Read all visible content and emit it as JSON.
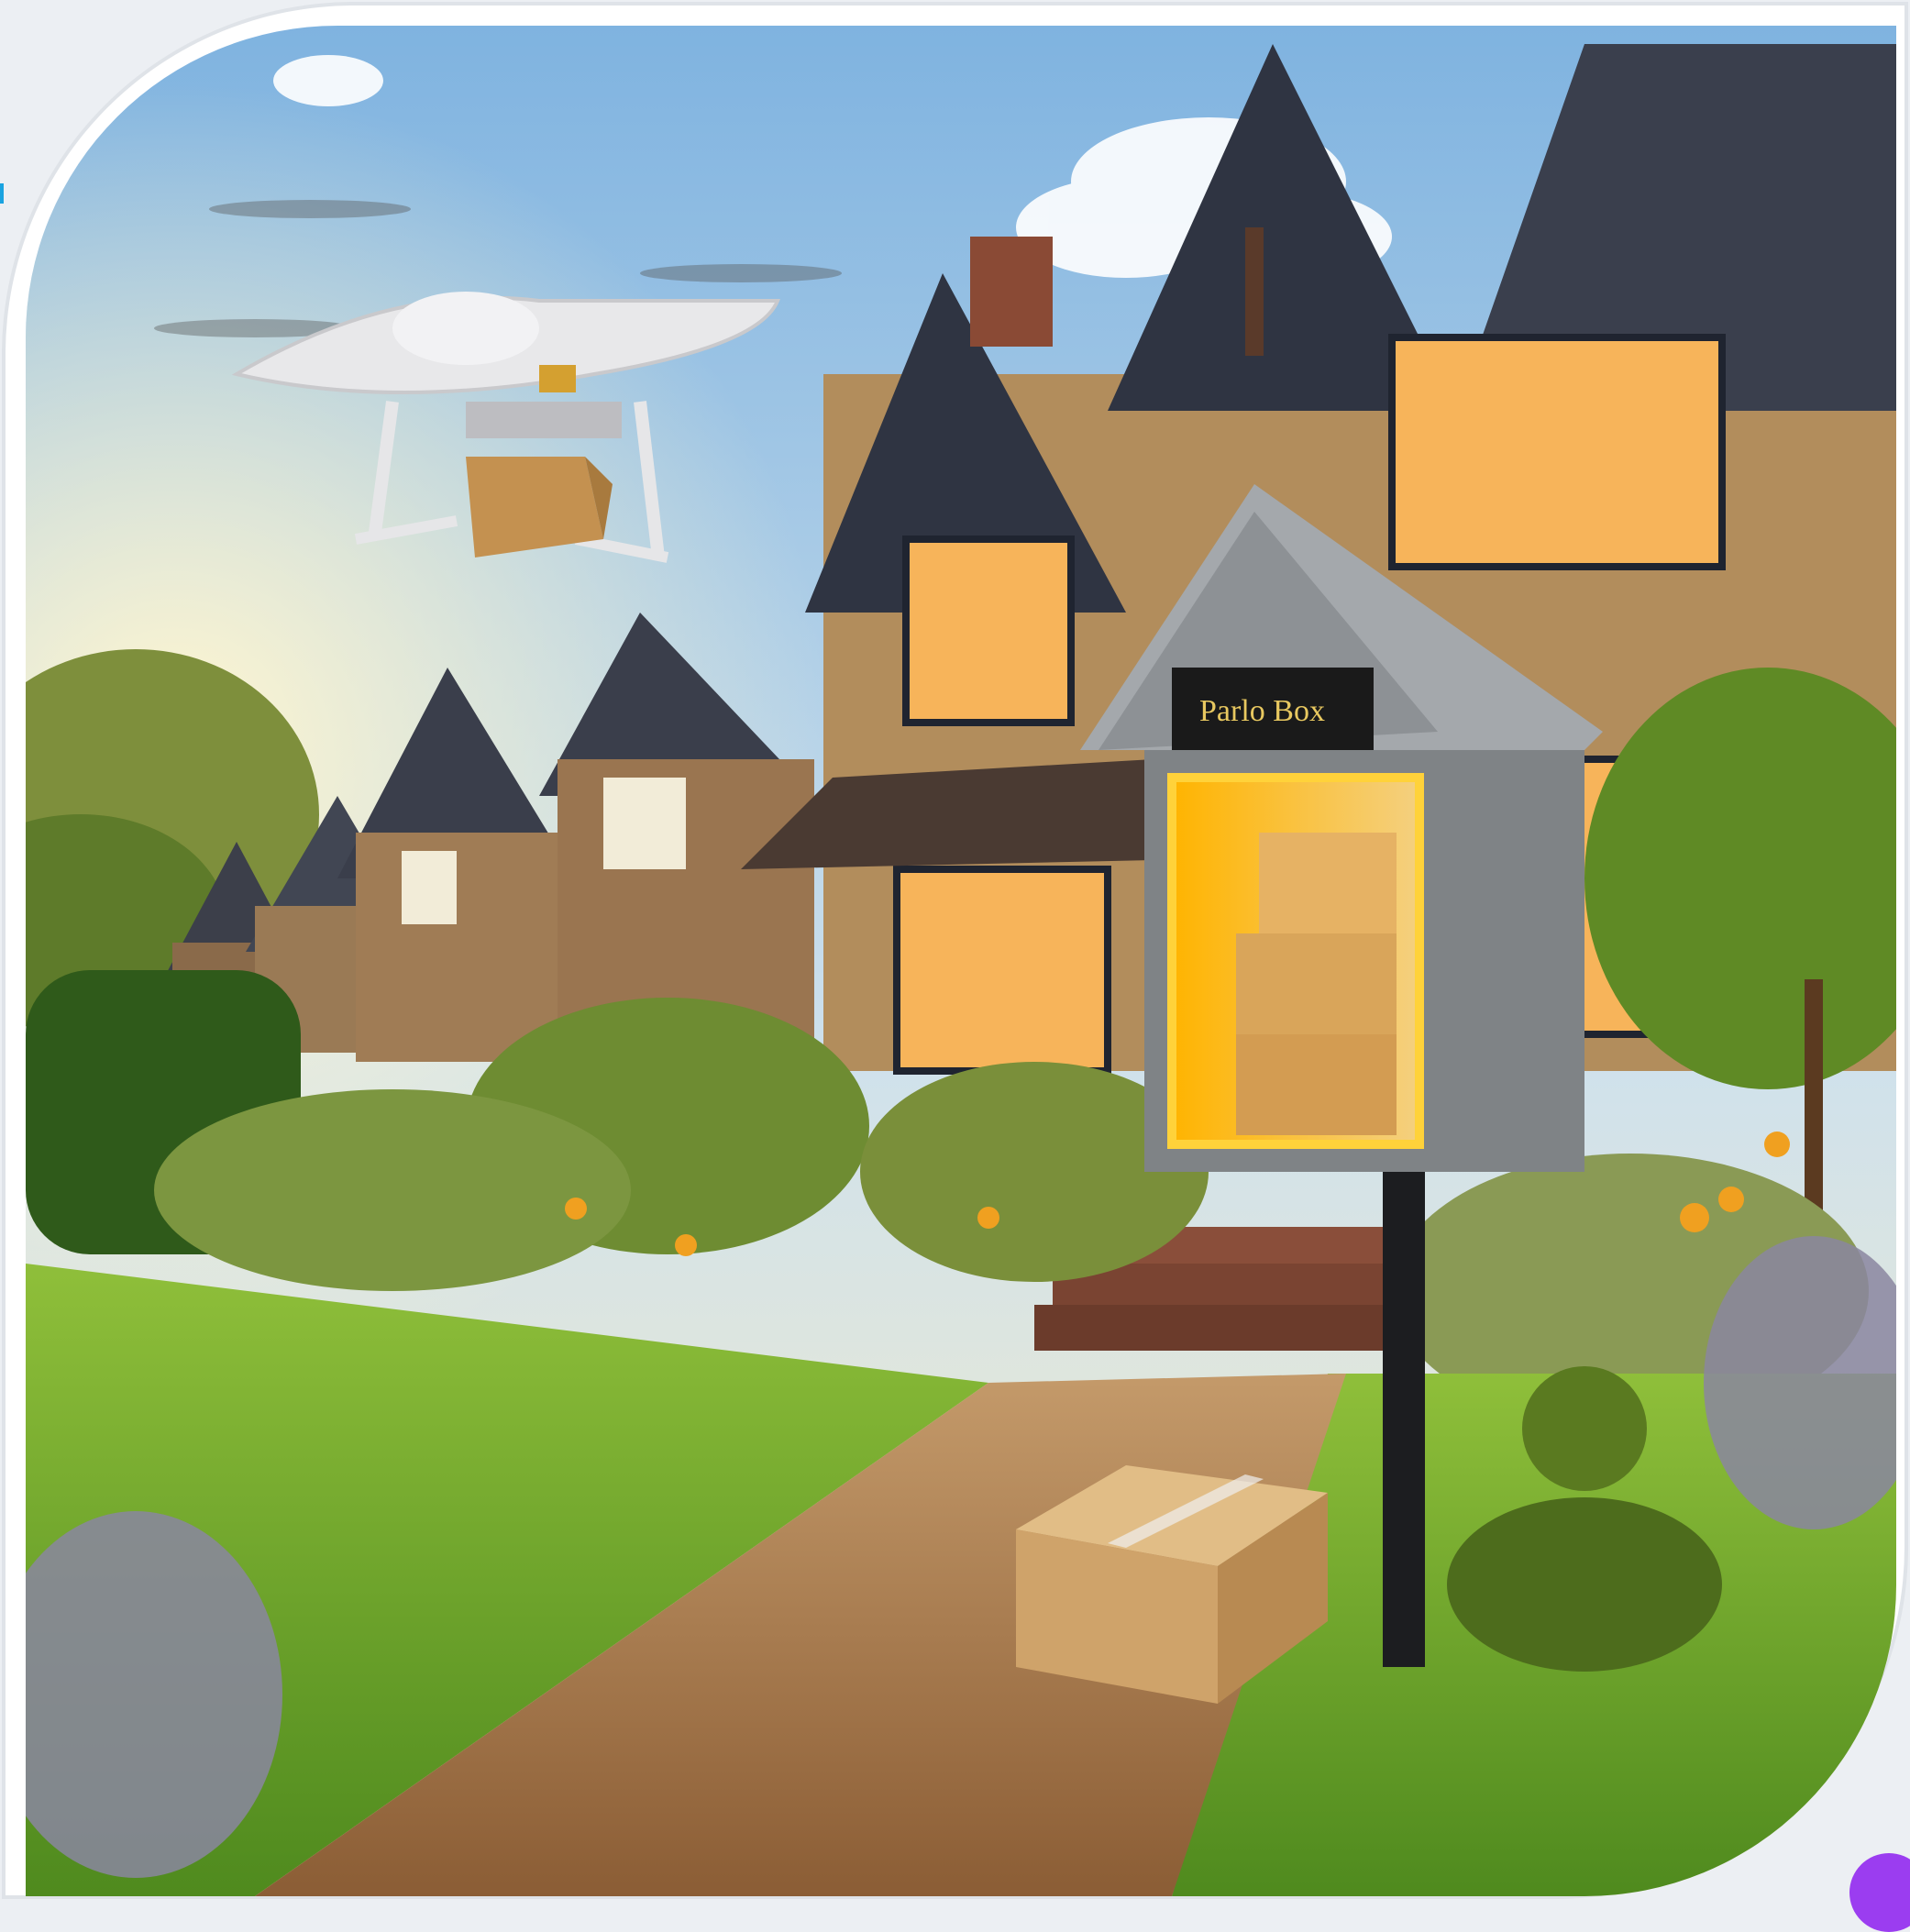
{
  "image": {
    "subject": "drone-package-delivery",
    "parcel_box_sign": "Parlo Box",
    "colors": {
      "sky_top": "#8fbfe6",
      "sky_bottom": "#f6ecc6",
      "grass": "#6fa62a",
      "path": "#b48858",
      "box_grey": "#7f8386",
      "box_glow": "#ffcc33",
      "cardboard": "#d2a86b",
      "accent_badge": "#9b3df0",
      "accent_mark": "#1aa3e0"
    },
    "icons": [
      "drone-icon",
      "parcel-icon",
      "house-icon",
      "parcel-box-icon"
    ]
  }
}
